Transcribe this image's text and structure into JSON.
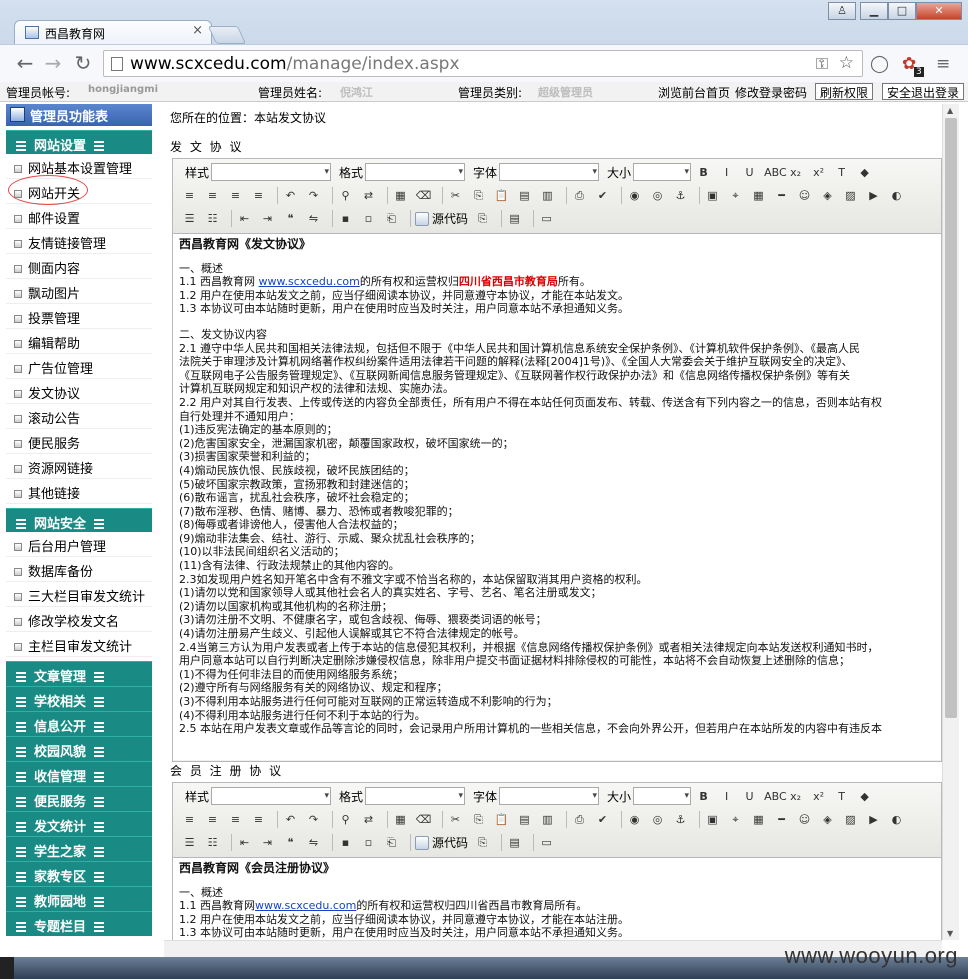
{
  "browser": {
    "tab_title": "西昌教育网",
    "tab_close": "×",
    "url_host": "www.scxcedu.com",
    "url_path": "/manage/index.aspx",
    "badge": "3",
    "win_min": "▁",
    "win_max": "□",
    "win_close": "✕",
    "win_user": "♙"
  },
  "topbar": {
    "account_label": "管理员帐号:",
    "account_value": "hongjiangmi",
    "name_label": "管理员姓名:",
    "name_value": "倪鸿江",
    "type_label": "管理员类别:",
    "type_value": "超级管理员",
    "link_front": "浏览前台首页",
    "link_pwd": "修改登录密码",
    "btn_refresh": "刷新权限",
    "btn_logout": "安全退出登录"
  },
  "sidebar": {
    "header": "管理员功能表",
    "site_settings": "网站设置",
    "site_items": [
      "网站基本设置管理",
      "网站开关",
      "邮件设置",
      "友情链接管理",
      "侧面内容",
      "飘动图片",
      "投票管理",
      "编辑帮助",
      "广告位管理",
      "发文协议",
      "滚动公告",
      "便民服务",
      "资源网链接",
      "其他链接"
    ],
    "site_security": "网站安全",
    "security_items": [
      "后台用户管理",
      "数据库备份",
      "三大栏目审发文统计",
      "修改学校发文名",
      "主栏目审发文统计"
    ],
    "sections": [
      "文章管理",
      "学校相关",
      "信息公开",
      "校园风貌",
      "收信管理",
      "便民服务",
      "发文统计",
      "学生之家",
      "家教专区",
      "教师园地",
      "专题栏目"
    ]
  },
  "main": {
    "location": "您所在的位置：本站发文协议",
    "label_publish": "发 文 协 议",
    "label_register": "会 员 注 册 协 议"
  },
  "editor": {
    "style": "样式",
    "format": "格式",
    "font": "字体",
    "size": "大小",
    "source": "源代码"
  },
  "doc1": {
    "title": "西昌教育网《发文协议》",
    "s1": "一、概述",
    "l1a": "1.1 西昌教育网 ",
    "l1link": "www.scxcedu.com",
    "l1b": "的所有权和运营权归",
    "l1red": "四川省西昌市教育局",
    "l1c": "所有。",
    "l2": "1.2 用户在使用本站发文之前，应当仔细阅读本协议，并同意遵守本协议，才能在本站发文。",
    "l3": "1.3 本协议可由本站随时更新，用户在使用时应当及时关注，用户同意本站不承担通知义务。",
    "s2": "二、发文协议内容",
    "lines": [
      "2.1 遵守中华人民共和国相关法律法规，包括但不限于《中华人民共和国计算机信息系统安全保护条例》、《计算机软件保护条例》、《最高人民",
      "法院关于审理涉及计算机网络著作权纠纷案件适用法律若干问题的解释(法释[2004]1号)》、《全国人大常委会关于维护互联网安全的决定》、",
      "《互联网电子公告服务管理规定》、《互联网新闻信息服务管理规定》、《互联网著作权行政保护办法》和《信息网络传播权保护条例》等有关",
      "计算机互联网规定和知识产权的法律和法规、实施办法。",
      "2.2 用户对其自行发表、上传或传送的内容负全部责任，所有用户不得在本站任何页面发布、转载、传送含有下列内容之一的信息，否则本站有权",
      "自行处理并不通知用户：",
      "(1)违反宪法确定的基本原则的；",
      "(2)危害国家安全，泄漏国家机密，颠覆国家政权，破坏国家统一的；",
      "(3)损害国家荣誉和利益的；",
      "(4)煽动民族仇恨、民族歧视，破坏民族团结的；",
      "(5)破坏国家宗教政策，宣扬邪教和封建迷信的；",
      "(6)散布谣言，扰乱社会秩序，破坏社会稳定的；",
      "(7)散布淫秽、色情、赌博、暴力、恐怖或者教唆犯罪的；",
      "(8)侮辱或者诽谤他人，侵害他人合法权益的；",
      "(9)煽动非法集会、结社、游行、示威、聚众扰乱社会秩序的；",
      "(10)以非法民间组织名义活动的；",
      "(11)含有法律、行政法规禁止的其他内容的。",
      "2.3如发现用户姓名知开笔名中含有不雅文字或不恰当名称的，本站保留取消其用户资格的权利。",
      "(1)请勿以党和国家领导人或其他社会名人的真实姓名、字号、艺名、笔名注册或发文；",
      "(2)请勿以国家机构或其他机构的名称注册；",
      "(3)请勿注册不文明、不健康名字，或包含歧视、侮辱、猥亵类词语的帐号；",
      "(4)请勿注册易产生歧义、引起他人误解或其它不符合法律规定的帐号。",
      "2.4当第三方认为用户发表或者上传于本站的信息侵犯其权利，并根据《信息网络传播权保护条例》或者相关法律规定向本站发送权利通知书时，",
      "用户同意本站可以自行判断决定删除涉嫌侵权信息，除非用户提交书面证据材料排除侵权的可能性，本站将不会自动恢复上述删除的信息；",
      "(1)不得为任何非法目的而使用网络服务系统；",
      "(2)遵守所有与网络服务有关的网络协议、规定和程序；",
      "(3)不得利用本站服务进行任何可能对互联网的正常运转造成不利影响的行为；",
      "(4)不得利用本站服务进行任何不利于本站的行为。",
      "2.5 本站在用户发表文章或作品等言论的同时，会记录用户所用计算机的一些相关信息，不会向外界公开，但若用户在本站所发的内容中有违反本"
    ]
  },
  "doc2": {
    "title": "西昌教育网《会员注册协议》",
    "s1": "一、概述",
    "l1a": "1.1 西昌教育网",
    "l1link": "www.scxcedu.com",
    "l1b": "的所有权和运营权归四川省西昌市教育局所有。",
    "l2": "1.2 用户在使用本站发文之前，应当仔细阅读本协议，并同意遵守本协议，才能在本站注册。",
    "l3": "1.3 本协议可由本站随时更新，用户在使用时应当及时关注，用户同意本站不承担通知义务。"
  },
  "watermark": "www.wooyun.org"
}
